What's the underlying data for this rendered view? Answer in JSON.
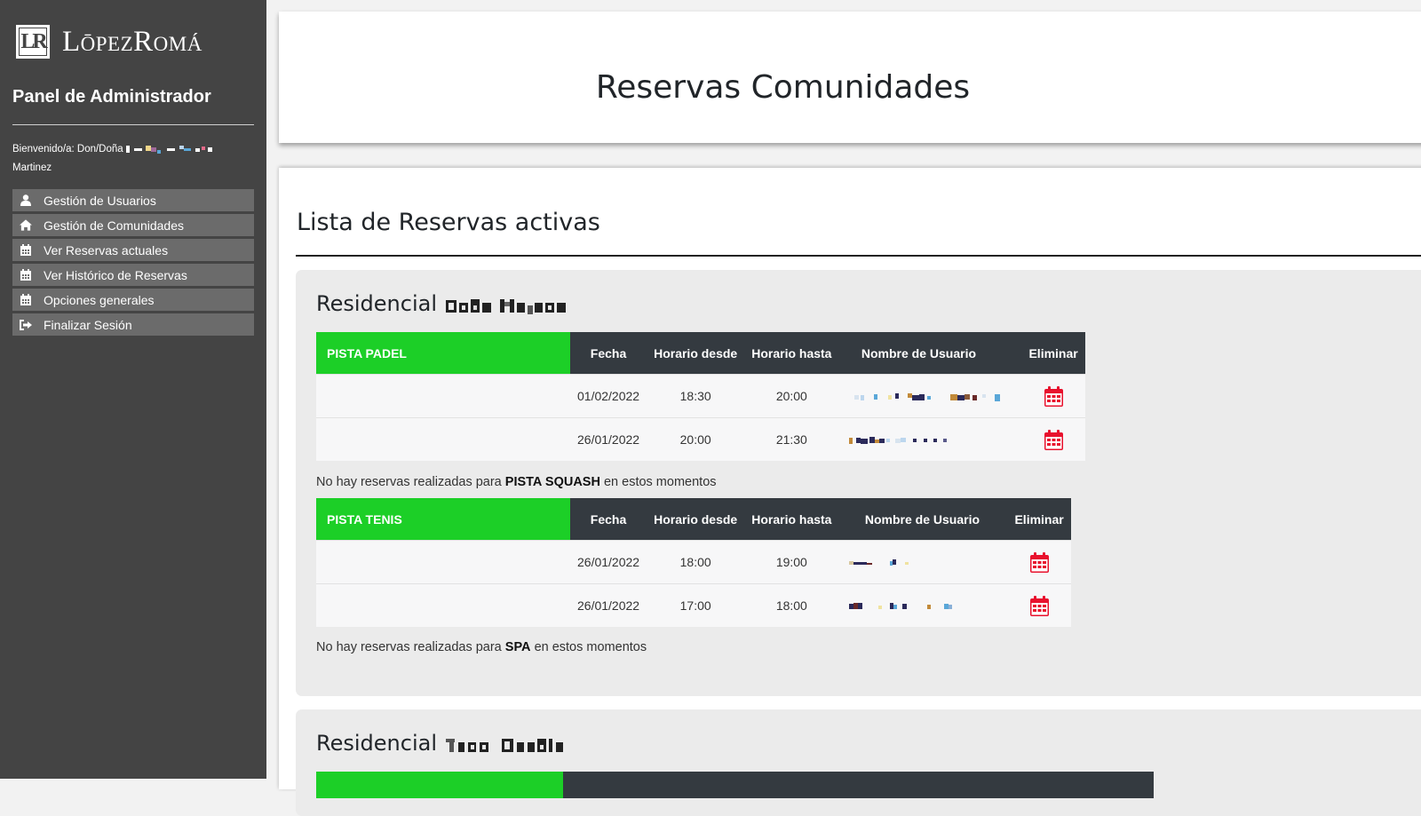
{
  "sidebar": {
    "logo_mark": "LR",
    "logo_text": "LōpezRomá",
    "panel_title": "Panel de Administrador",
    "welcome_prefix": "Bienvenido/a: Don/Doña",
    "welcome_surname": "Martinez",
    "menu": [
      {
        "label": "Gestión de Usuarios",
        "icon": "user-icon"
      },
      {
        "label": "Gestión de Comunidades",
        "icon": "home-icon"
      },
      {
        "label": "Ver Reservas actuales",
        "icon": "calendar-icon"
      },
      {
        "label": "Ver Histórico de Reservas",
        "icon": "calendar-icon"
      },
      {
        "label": "Opciones generales",
        "icon": "calendar-icon"
      },
      {
        "label": "Finalizar Sesión",
        "icon": "sign-out-icon"
      }
    ]
  },
  "header": {
    "title": "Reservas Comunidades"
  },
  "content": {
    "title": "Lista de Reservas activas"
  },
  "columns": [
    "Fecha",
    "Horario desde",
    "Horario hasta",
    "Nombre de Usuario",
    "Eliminar"
  ],
  "communities": [
    {
      "title_prefix": "Residencial",
      "padel": {
        "name": "PISTA PADEL",
        "rows": [
          {
            "fecha": "01/02/2022",
            "desde": "18:30",
            "hasta": "20:00"
          },
          {
            "fecha": "26/01/2022",
            "desde": "20:00",
            "hasta": "21:30"
          }
        ]
      },
      "squash_note": {
        "prefix": "No hay reservas realizadas para",
        "facility": "PISTA SQUASH",
        "suffix": "en estos momentos"
      },
      "tenis": {
        "name": "PISTA TENIS",
        "rows": [
          {
            "fecha": "26/01/2022",
            "desde": "18:00",
            "hasta": "19:00"
          },
          {
            "fecha": "26/01/2022",
            "desde": "17:00",
            "hasta": "18:00"
          }
        ]
      },
      "spa_note": {
        "prefix": "No hay reservas realizadas para",
        "facility": "SPA",
        "suffix": "en estos momentos"
      }
    },
    {
      "title_prefix": "Residencial"
    }
  ],
  "colors": {
    "sidebar_bg": "#444444",
    "menu_item_bg": "#6b6b6b",
    "facility_header": "#1ccf27",
    "table_header": "#343a40",
    "delete_icon": "#e8112d"
  }
}
